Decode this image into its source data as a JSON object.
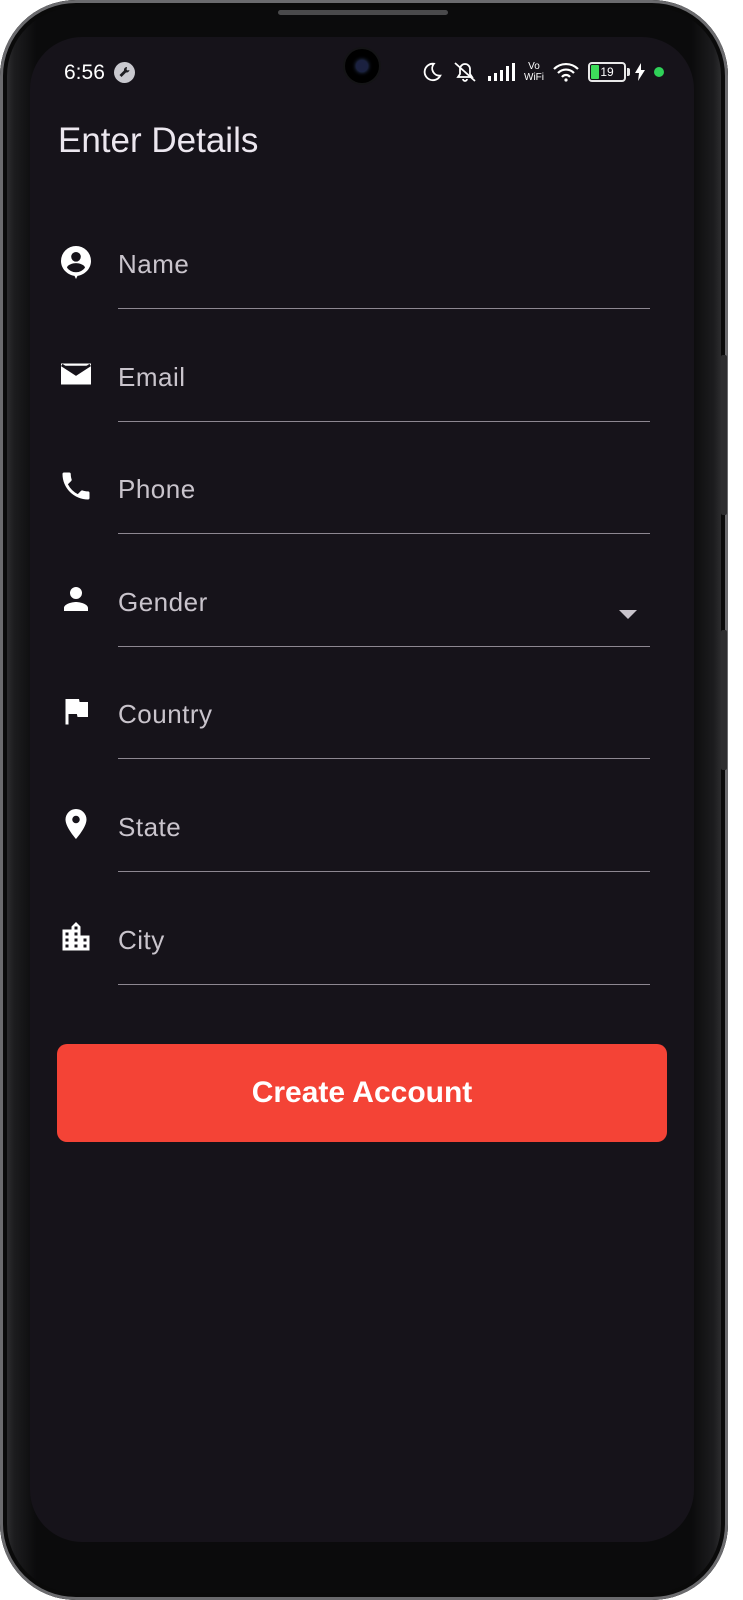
{
  "status_bar": {
    "time": "6:56",
    "network_label_top": "Vo",
    "network_label_bottom": "WiFi",
    "battery_level": "19"
  },
  "page": {
    "title": "Enter Details"
  },
  "form": {
    "fields": [
      {
        "label": "Name",
        "icon": "account-circle-icon"
      },
      {
        "label": "Email",
        "icon": "mail-icon"
      },
      {
        "label": "Phone",
        "icon": "phone-icon"
      },
      {
        "label": "Gender",
        "icon": "person-icon",
        "type": "dropdown"
      },
      {
        "label": "Country",
        "icon": "flag-icon"
      },
      {
        "label": "State",
        "icon": "location-pin-icon"
      },
      {
        "label": "City",
        "icon": "city-icon"
      }
    ],
    "submit_label": "Create Account"
  },
  "colors": {
    "background": "#16131a",
    "accent": "#f44336",
    "text": "#c9c4cc"
  }
}
